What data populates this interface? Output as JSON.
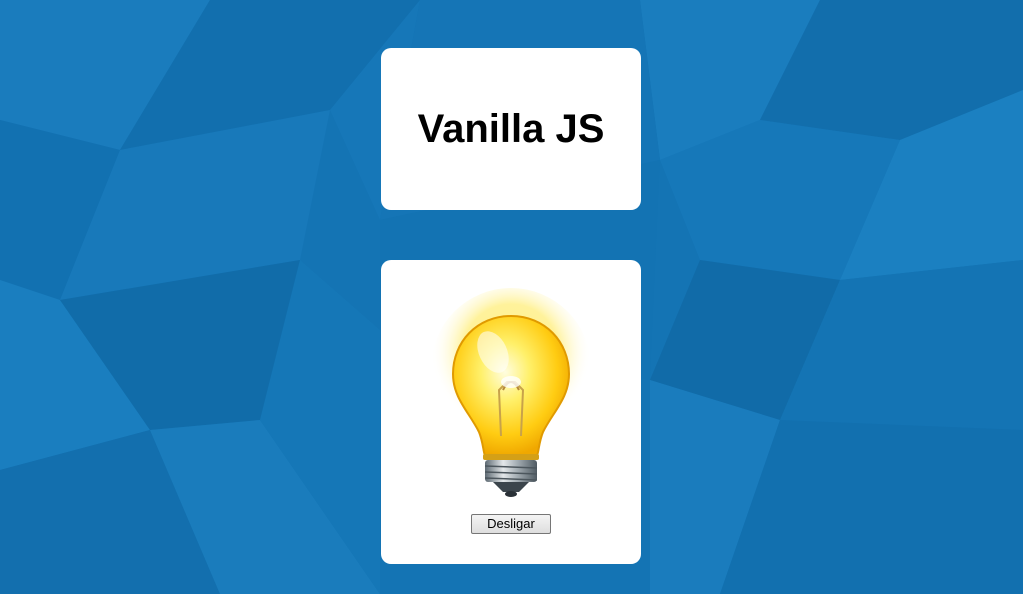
{
  "header": {
    "title": "Vanilla JS"
  },
  "lamp": {
    "state": "on",
    "icon": "lightbulb-on-icon",
    "button_label": "Desligar"
  },
  "colors": {
    "background": "#1474b4",
    "card": "#ffffff",
    "bulb_glow": "#ffd700"
  }
}
